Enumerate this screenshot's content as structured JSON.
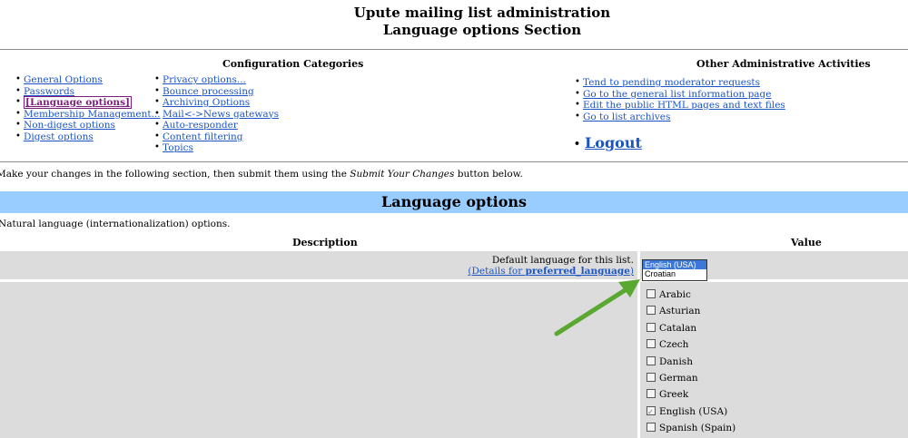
{
  "header": {
    "title_line1": "Upute mailing list administration",
    "title_line2": "Language options Section"
  },
  "config": {
    "heading": "Configuration Categories",
    "col1": [
      "General Options",
      "Passwords",
      "[Language options]",
      "Membership Management...",
      "Non-digest options",
      "Digest options"
    ],
    "col2": [
      "Privacy options...",
      "Bounce processing",
      "Archiving Options",
      "Mail<->News gateways",
      "Auto-responder",
      "Content filtering",
      "Topics"
    ]
  },
  "other": {
    "heading": "Other Administrative Activities",
    "links": [
      "Tend to pending moderator requests",
      "Go to the general list information page",
      "Edit the public HTML pages and text files",
      "Go to list archives"
    ],
    "logout": "Logout"
  },
  "intro": {
    "before": "Make your changes in the following section, then submit them using the ",
    "emph": "Submit Your Changes",
    "after": " button below."
  },
  "section": {
    "title": "Language options",
    "subtitle": "Natural language (internationalization) options."
  },
  "table": {
    "col_description": "Description",
    "col_value": "Value"
  },
  "preferred_language": {
    "description": "Default language for this list.",
    "details_prefix": "(Details for ",
    "details_name": "preferred_language",
    "details_suffix": ")",
    "options": [
      "English (USA)",
      "Croatian"
    ],
    "selected": "English (USA)"
  },
  "available_languages": [
    {
      "label": "Arabic",
      "checked": false
    },
    {
      "label": "Asturian",
      "checked": false
    },
    {
      "label": "Catalan",
      "checked": false
    },
    {
      "label": "Czech",
      "checked": false
    },
    {
      "label": "Danish",
      "checked": false
    },
    {
      "label": "German",
      "checked": false
    },
    {
      "label": "Greek",
      "checked": false
    },
    {
      "label": "English (USA)",
      "checked": true
    },
    {
      "label": "Spanish (Spain)",
      "checked": false
    }
  ],
  "colors": {
    "banner": "#99ccff",
    "link": "#1b55c5",
    "visited": "#7b1f7b",
    "cell_bg": "#dcdcdc",
    "arrow": "#5aa832",
    "selected_option": "#3b78d8"
  }
}
